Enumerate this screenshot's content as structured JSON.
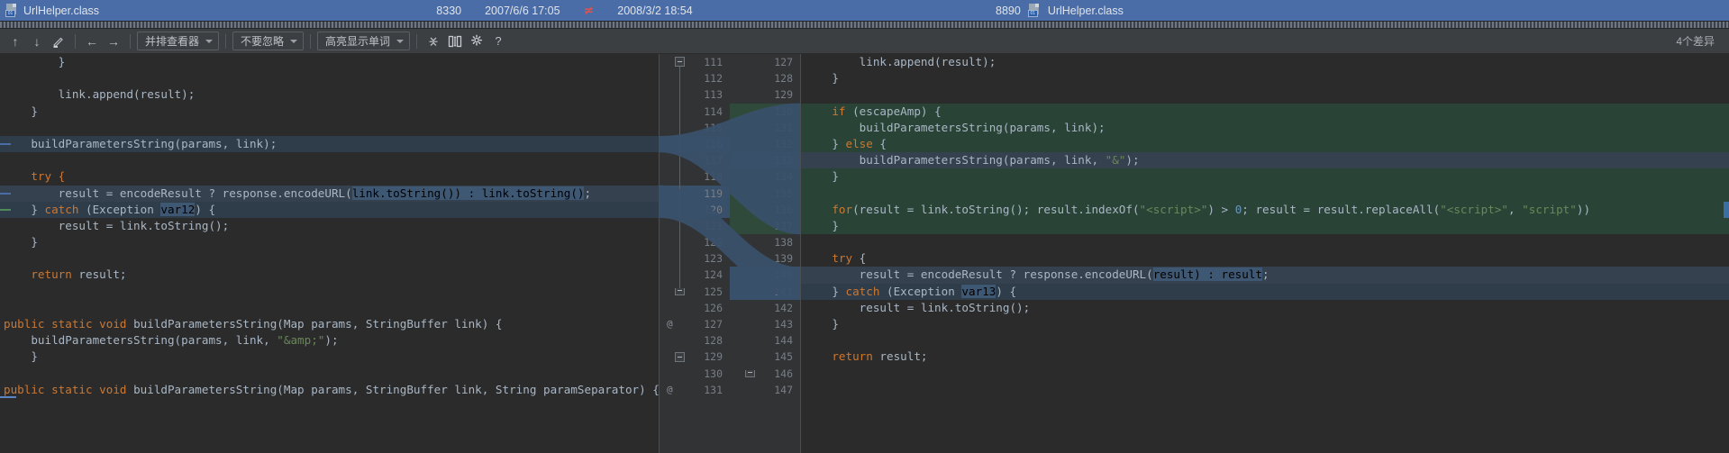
{
  "window": {
    "title": "UrlHelper.class",
    "file_icon": "java-class-file-icon",
    "badge_text": "01"
  },
  "titlebar": {
    "left_size": "8330",
    "left_timestamp": "2007/6/6 17:05",
    "compare_glyph": "≠",
    "right_timestamp": "2008/3/2 18:54",
    "right_size": "8890",
    "right_title": "UrlHelper.class"
  },
  "toolbar": {
    "prev_diff_icon": "arrow-up-icon",
    "next_diff_icon": "arrow-down-icon",
    "edit_icon": "pencil-icon",
    "apply_left_icon": "arrow-left-icon",
    "apply_right_icon": "arrow-right-icon",
    "viewer_mode": "并排查看器",
    "ignore_mode": "不要忽略",
    "highlight_mode": "高亮显示单词",
    "collapse_icon": "collapse-unchanged-icon",
    "sync_scroll_icon": "sync-scroll-icon",
    "settings_icon": "gear-icon",
    "help_icon": "help-icon",
    "diff_count": "4个差异"
  },
  "left_pane": {
    "name": "left-diff-editor",
    "first_line": 111,
    "lines": [
      {
        "n": 111,
        "bg": "plain",
        "fold": "start",
        "mark": "",
        "tokens": [
          {
            "t": "        }",
            "c": "punct"
          }
        ]
      },
      {
        "n": 112,
        "bg": "plain",
        "fold": "",
        "mark": "",
        "tokens": [
          {
            "t": "",
            "c": "punct"
          }
        ]
      },
      {
        "n": 113,
        "bg": "plain",
        "fold": "",
        "mark": "",
        "tokens": [
          {
            "t": "        link.append(result);",
            "c": "id"
          }
        ]
      },
      {
        "n": 114,
        "bg": "plain",
        "fold": "",
        "mark": "",
        "tokens": [
          {
            "t": "    }",
            "c": "punct"
          }
        ]
      },
      {
        "n": 115,
        "bg": "plain",
        "fold": "",
        "mark": "",
        "tokens": [
          {
            "t": "",
            "c": "punct"
          }
        ]
      },
      {
        "n": 116,
        "bg": "mod",
        "fold": "",
        "mark": "",
        "tokens": [
          {
            "t": "    buildParametersString(params, link);",
            "c": "id"
          }
        ]
      },
      {
        "n": 117,
        "bg": "plain",
        "fold": "",
        "mark": "",
        "tokens": [
          {
            "t": "",
            "c": "punct"
          }
        ]
      },
      {
        "n": 118,
        "bg": "plain",
        "fold": "",
        "mark": "",
        "tokens": [
          {
            "t": "    try {",
            "c": "kw"
          }
        ]
      },
      {
        "n": 119,
        "bg": "modline",
        "fold": "",
        "mark": "",
        "tokens": [
          {
            "t": "        result = encodeResult ? response.encodeURL(",
            "c": "id"
          },
          {
            "t": "link.toString()) : link.toString()",
            "c": "sel"
          },
          {
            "t": ";",
            "c": "id"
          }
        ]
      },
      {
        "n": 120,
        "bg": "mod",
        "fold": "",
        "mark": "",
        "tokens": [
          {
            "t": "    } ",
            "c": "punct"
          },
          {
            "t": "catch",
            "c": "kw"
          },
          {
            "t": " (Exception ",
            "c": "id"
          },
          {
            "t": "var12",
            "c": "sel"
          },
          {
            "t": ") {",
            "c": "id"
          }
        ]
      },
      {
        "n": 121,
        "bg": "plain",
        "fold": "",
        "mark": "",
        "tokens": [
          {
            "t": "        result = link.toString();",
            "c": "id"
          }
        ]
      },
      {
        "n": 122,
        "bg": "plain",
        "fold": "",
        "mark": "",
        "tokens": [
          {
            "t": "    }",
            "c": "punct"
          }
        ]
      },
      {
        "n": 123,
        "bg": "plain",
        "fold": "",
        "mark": "",
        "tokens": [
          {
            "t": "",
            "c": "punct"
          }
        ]
      },
      {
        "n": 124,
        "bg": "plain",
        "fold": "",
        "mark": "",
        "tokens": [
          {
            "t": "    ",
            "c": "id"
          },
          {
            "t": "return",
            "c": "kw"
          },
          {
            "t": " result;",
            "c": "id"
          }
        ]
      },
      {
        "n": 125,
        "bg": "plain",
        "fold": "end",
        "mark": "",
        "tokens": [
          {
            "t": "",
            "c": "punct"
          }
        ]
      },
      {
        "n": 126,
        "bg": "plain",
        "fold": "",
        "mark": "",
        "tokens": [
          {
            "t": "",
            "c": "punct"
          }
        ]
      },
      {
        "n": 127,
        "bg": "plain",
        "fold": "",
        "mark": "@",
        "tokens": [
          {
            "t": "public static void",
            "c": "kw"
          },
          {
            "t": " buildParametersString(Map params, StringBuffer link) {",
            "c": "id"
          }
        ]
      },
      {
        "n": 128,
        "bg": "plain",
        "fold": "",
        "mark": "",
        "tokens": [
          {
            "t": "    buildParametersString(params, link, ",
            "c": "id"
          },
          {
            "t": "\"&amp;\"",
            "c": "str"
          },
          {
            "t": ");",
            "c": "id"
          }
        ]
      },
      {
        "n": 129,
        "bg": "plain",
        "fold": "start",
        "mark": "",
        "tokens": [
          {
            "t": "    }",
            "c": "punct"
          }
        ]
      },
      {
        "n": 130,
        "bg": "plain",
        "fold": "",
        "mark": "",
        "tokens": [
          {
            "t": "",
            "c": "punct"
          }
        ]
      },
      {
        "n": 131,
        "bg": "plain",
        "fold": "",
        "mark": "@",
        "tokens": [
          {
            "t": "public static void",
            "c": "kw"
          },
          {
            "t": " buildParametersString(Map params, StringBuffer link, String paramSeparator) {",
            "c": "id"
          }
        ]
      }
    ]
  },
  "right_pane": {
    "name": "right-diff-editor",
    "first_line": 127,
    "lines": [
      {
        "n": 127,
        "bg": "plain",
        "fold": "",
        "mark": "",
        "tokens": [
          {
            "t": "        link.append(result);",
            "c": "id"
          }
        ]
      },
      {
        "n": 128,
        "bg": "plain",
        "fold": "",
        "mark": "",
        "tokens": [
          {
            "t": "    }",
            "c": "punct"
          }
        ]
      },
      {
        "n": 129,
        "bg": "plain",
        "fold": "",
        "mark": "",
        "tokens": [
          {
            "t": "",
            "c": "punct"
          }
        ]
      },
      {
        "n": 130,
        "bg": "add",
        "fold": "",
        "mark": "",
        "tokens": [
          {
            "t": "    if",
            "c": "kw"
          },
          {
            "t": " (escapeAmp) {",
            "c": "id"
          }
        ]
      },
      {
        "n": 131,
        "bg": "add",
        "fold": "",
        "mark": "",
        "tokens": [
          {
            "t": "        buildParametersString(params, link);",
            "c": "id"
          }
        ]
      },
      {
        "n": 132,
        "bg": "add",
        "fold": "",
        "mark": "",
        "tokens": [
          {
            "t": "    } ",
            "c": "punct"
          },
          {
            "t": "else",
            "c": "kw"
          },
          {
            "t": " {",
            "c": "id"
          }
        ]
      },
      {
        "n": 133,
        "bg": "modline",
        "fold": "",
        "mark": "",
        "tokens": [
          {
            "t": "        buildParametersString(params, link, ",
            "c": "id"
          },
          {
            "t": "\"&\"",
            "c": "str"
          },
          {
            "t": ");",
            "c": "id"
          }
        ]
      },
      {
        "n": 134,
        "bg": "add",
        "fold": "",
        "mark": "",
        "tokens": [
          {
            "t": "    }",
            "c": "punct"
          }
        ]
      },
      {
        "n": 135,
        "bg": "add",
        "fold": "",
        "mark": "",
        "tokens": [
          {
            "t": "",
            "c": "punct"
          }
        ]
      },
      {
        "n": 136,
        "bg": "add",
        "fold": "",
        "mark": "",
        "tokens": [
          {
            "t": "    for",
            "c": "kw"
          },
          {
            "t": "(result = link.toString(); result.indexOf(",
            "c": "id"
          },
          {
            "t": "\"<script>\"",
            "c": "str"
          },
          {
            "t": ") > ",
            "c": "id"
          },
          {
            "t": "0",
            "c": "num"
          },
          {
            "t": "; result = result.replaceAll(",
            "c": "id"
          },
          {
            "t": "\"<script>\"",
            "c": "str"
          },
          {
            "t": ", ",
            "c": "id"
          },
          {
            "t": "\"script\"",
            "c": "str"
          },
          {
            "t": "))",
            "c": "id"
          }
        ]
      },
      {
        "n": 137,
        "bg": "add",
        "fold": "",
        "mark": "",
        "tokens": [
          {
            "t": "    }",
            "c": "punct"
          }
        ]
      },
      {
        "n": 138,
        "bg": "plain",
        "fold": "",
        "mark": "",
        "tokens": [
          {
            "t": "",
            "c": "punct"
          }
        ]
      },
      {
        "n": 139,
        "bg": "plain",
        "fold": "",
        "mark": "",
        "tokens": [
          {
            "t": "    try",
            "c": "kw"
          },
          {
            "t": " {",
            "c": "id"
          }
        ]
      },
      {
        "n": 140,
        "bg": "modline",
        "fold": "",
        "mark": "",
        "tokens": [
          {
            "t": "        result = encodeResult ? response.encodeURL(",
            "c": "id"
          },
          {
            "t": "result) : result",
            "c": "sel"
          },
          {
            "t": ";",
            "c": "id"
          }
        ]
      },
      {
        "n": 141,
        "bg": "mod",
        "fold": "",
        "mark": "",
        "tokens": [
          {
            "t": "    } ",
            "c": "punct"
          },
          {
            "t": "catch",
            "c": "kw"
          },
          {
            "t": " (Exception ",
            "c": "id"
          },
          {
            "t": "var13",
            "c": "sel"
          },
          {
            "t": ") {",
            "c": "id"
          }
        ]
      },
      {
        "n": 142,
        "bg": "plain",
        "fold": "",
        "mark": "",
        "tokens": [
          {
            "t": "        result = link.toString();",
            "c": "id"
          }
        ]
      },
      {
        "n": 143,
        "bg": "plain",
        "fold": "",
        "mark": "",
        "tokens": [
          {
            "t": "    }",
            "c": "punct"
          }
        ]
      },
      {
        "n": 144,
        "bg": "plain",
        "fold": "",
        "mark": "",
        "tokens": [
          {
            "t": "",
            "c": "punct"
          }
        ]
      },
      {
        "n": 145,
        "bg": "plain",
        "fold": "",
        "mark": "",
        "tokens": [
          {
            "t": "    ",
            "c": "id"
          },
          {
            "t": "return",
            "c": "kw"
          },
          {
            "t": " result;",
            "c": "id"
          }
        ]
      },
      {
        "n": 146,
        "bg": "plain",
        "fold": "end",
        "mark": "",
        "tokens": [
          {
            "t": "",
            "c": "punct"
          }
        ]
      },
      {
        "n": 147,
        "bg": "plain",
        "fold": "",
        "mark": "",
        "tokens": [
          {
            "t": "",
            "c": "punct"
          }
        ]
      }
    ]
  }
}
